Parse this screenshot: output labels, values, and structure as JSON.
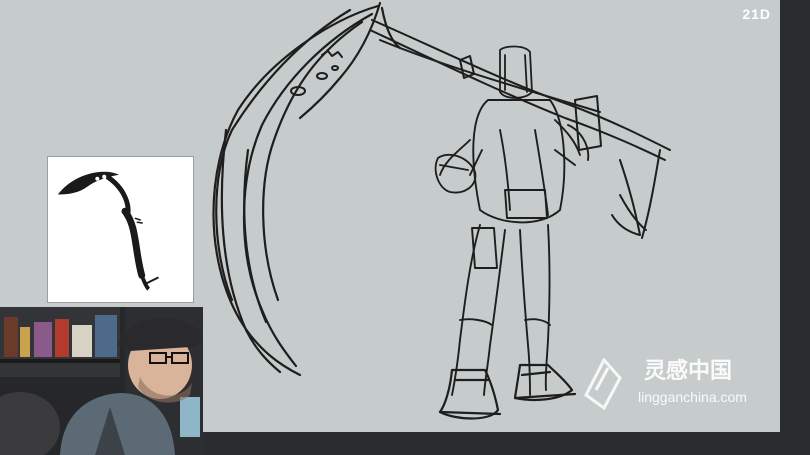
{
  "app": {
    "brand_logo": "21D"
  },
  "reference_panel": {
    "icon": "scythe-reference-image"
  },
  "webcam": {
    "icon": "presenter-webcam-feed"
  },
  "watermark": {
    "chinese_text": "灵感中国",
    "url_text": "lingganchina.com"
  },
  "colors": {
    "canvas": "#c6cccb",
    "ui_dark": "#2b2c2e",
    "stroke": "#1c1c1c",
    "reference_bg": "#ffffff"
  }
}
